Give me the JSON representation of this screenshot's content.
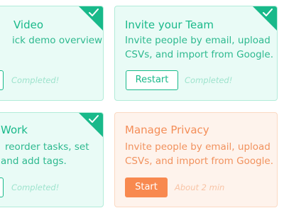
{
  "colors": {
    "completed_accent": "#19b98a",
    "completed_bg": "#e9fbf6",
    "pending_accent": "#f8894f",
    "pending_bg": "#fef3ec"
  },
  "cards": [
    {
      "title": "Video",
      "description": [
        "ick demo overview"
      ],
      "status": "Completed!",
      "completed": true,
      "icon": "checkmark-icon"
    },
    {
      "title": "Invite your Team",
      "description": [
        "Invite people by email, upload",
        "CSVs, and import from Google."
      ],
      "button": "Restart",
      "status": "Completed!",
      "completed": true,
      "icon": "checkmark-icon"
    },
    {
      "title": "Work",
      "description": [
        "reorder tasks, set",
        "and add tags."
      ],
      "status": "Completed!",
      "completed": true,
      "icon": "checkmark-icon"
    },
    {
      "title": "Manage Privacy",
      "description": [
        "Invite people by email, upload",
        "CSVs, and import from Google."
      ],
      "button": "Start",
      "status": "About 2 min",
      "completed": false
    }
  ]
}
